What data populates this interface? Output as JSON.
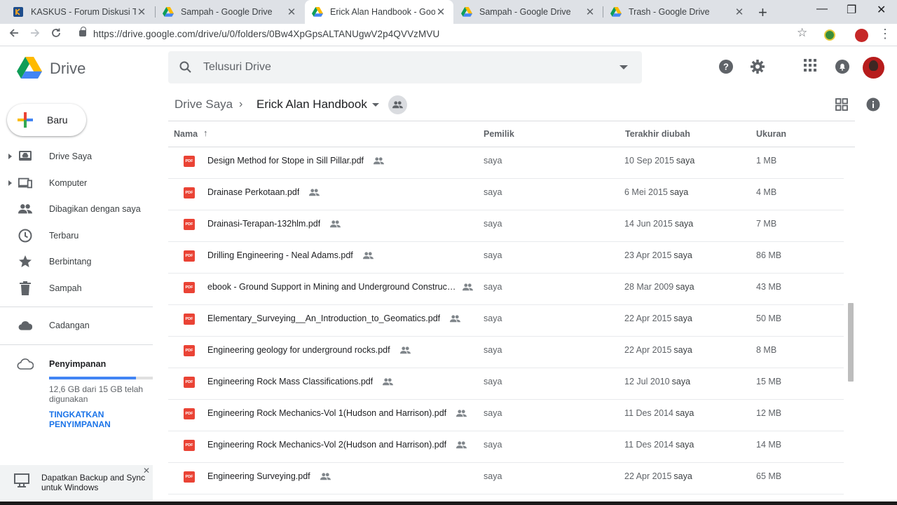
{
  "browser": {
    "tabs": [
      {
        "title": "KASKUS - Forum Diskusi Terbe",
        "active": false
      },
      {
        "title": "Sampah - Google Drive",
        "active": false
      },
      {
        "title": "Erick Alan Handbook - Google",
        "active": true
      },
      {
        "title": "Sampah - Google Drive",
        "active": false
      },
      {
        "title": "Trash - Google Drive",
        "active": false
      }
    ],
    "close_glyph": "✕",
    "new_tab": "+",
    "url": "https://drive.google.com/drive/u/0/folders/0Bw4XpGpsALTANUgwV2p4QVVzMVU",
    "window_controls": {
      "minimize": "—",
      "maximize": "❐",
      "close": "✕"
    }
  },
  "app": {
    "name": "Drive",
    "search_placeholder": "Telusuri Drive"
  },
  "sidebar": {
    "new_label": "Baru",
    "items": [
      {
        "label": "Drive Saya",
        "icon": "my-drive-icon",
        "expandable": true
      },
      {
        "label": "Komputer",
        "icon": "computers-icon",
        "expandable": true
      },
      {
        "label": "Dibagikan dengan saya",
        "icon": "shared-with-me-icon",
        "expandable": false
      },
      {
        "label": "Terbaru",
        "icon": "recent-icon",
        "expandable": false
      },
      {
        "label": "Berbintang",
        "icon": "starred-icon",
        "expandable": false
      },
      {
        "label": "Sampah",
        "icon": "trash-icon",
        "expandable": false
      }
    ],
    "backups_label": "Cadangan",
    "storage": {
      "title": "Penyimpanan",
      "usage_text": "12,6 GB dari 15 GB telah digunakan",
      "used_fraction": 0.84,
      "upgrade_label": "TINGKATKAN PENYIMPANAN"
    },
    "promo": {
      "text": "Dapatkan Backup and Sync untuk Windows",
      "close": "✕"
    }
  },
  "breadcrumb": {
    "root": "Drive Saya",
    "separator": "›",
    "current": "Erick Alan Handbook"
  },
  "table": {
    "columns": {
      "name": "Nama",
      "owner": "Pemilik",
      "modified": "Terakhir diubah",
      "size": "Ukuran"
    },
    "sort_arrow": "↑",
    "files": [
      {
        "name": "Design Method for Stope in Sill Pillar.pdf",
        "owner": "saya",
        "modified_date": "10 Sep 2015",
        "modified_by": "saya",
        "size": "1 MB"
      },
      {
        "name": "Drainase Perkotaan.pdf",
        "owner": "saya",
        "modified_date": "6 Mei 2015",
        "modified_by": "saya",
        "size": "4 MB"
      },
      {
        "name": "Drainasi-Terapan-132hlm.pdf",
        "owner": "saya",
        "modified_date": "14 Jun 2015",
        "modified_by": "saya",
        "size": "7 MB"
      },
      {
        "name": "Drilling Engineering - Neal Adams.pdf",
        "owner": "saya",
        "modified_date": "23 Apr 2015",
        "modified_by": "saya",
        "size": "86 MB"
      },
      {
        "name": "ebook - Ground Support in Mining and Underground Construction.pdf",
        "owner": "saya",
        "modified_date": "28 Mar 2009",
        "modified_by": "saya",
        "size": "43 MB"
      },
      {
        "name": "Elementary_Surveying__An_Introduction_to_Geomatics.pdf",
        "owner": "saya",
        "modified_date": "22 Apr 2015",
        "modified_by": "saya",
        "size": "50 MB"
      },
      {
        "name": "Engineering geology for underground rocks.pdf",
        "owner": "saya",
        "modified_date": "22 Apr 2015",
        "modified_by": "saya",
        "size": "8 MB"
      },
      {
        "name": "Engineering Rock Mass Classifications.pdf",
        "owner": "saya",
        "modified_date": "12 Jul 2010",
        "modified_by": "saya",
        "size": "15 MB"
      },
      {
        "name": "Engineering Rock Mechanics-Vol 1(Hudson and Harrison).pdf",
        "owner": "saya",
        "modified_date": "11 Des 2014",
        "modified_by": "saya",
        "size": "12 MB"
      },
      {
        "name": "Engineering Rock Mechanics-Vol 2(Hudson and Harrison).pdf",
        "owner": "saya",
        "modified_date": "11 Des 2014",
        "modified_by": "saya",
        "size": "14 MB"
      },
      {
        "name": "Engineering Surveying.pdf",
        "owner": "saya",
        "modified_date": "22 Apr 2015",
        "modified_by": "saya",
        "size": "65 MB"
      }
    ],
    "file_badge": "PDF"
  },
  "colors": {
    "pdf_red": "#ea4335",
    "link_blue": "#1a73e8",
    "storage_blue": "#4285f4"
  }
}
